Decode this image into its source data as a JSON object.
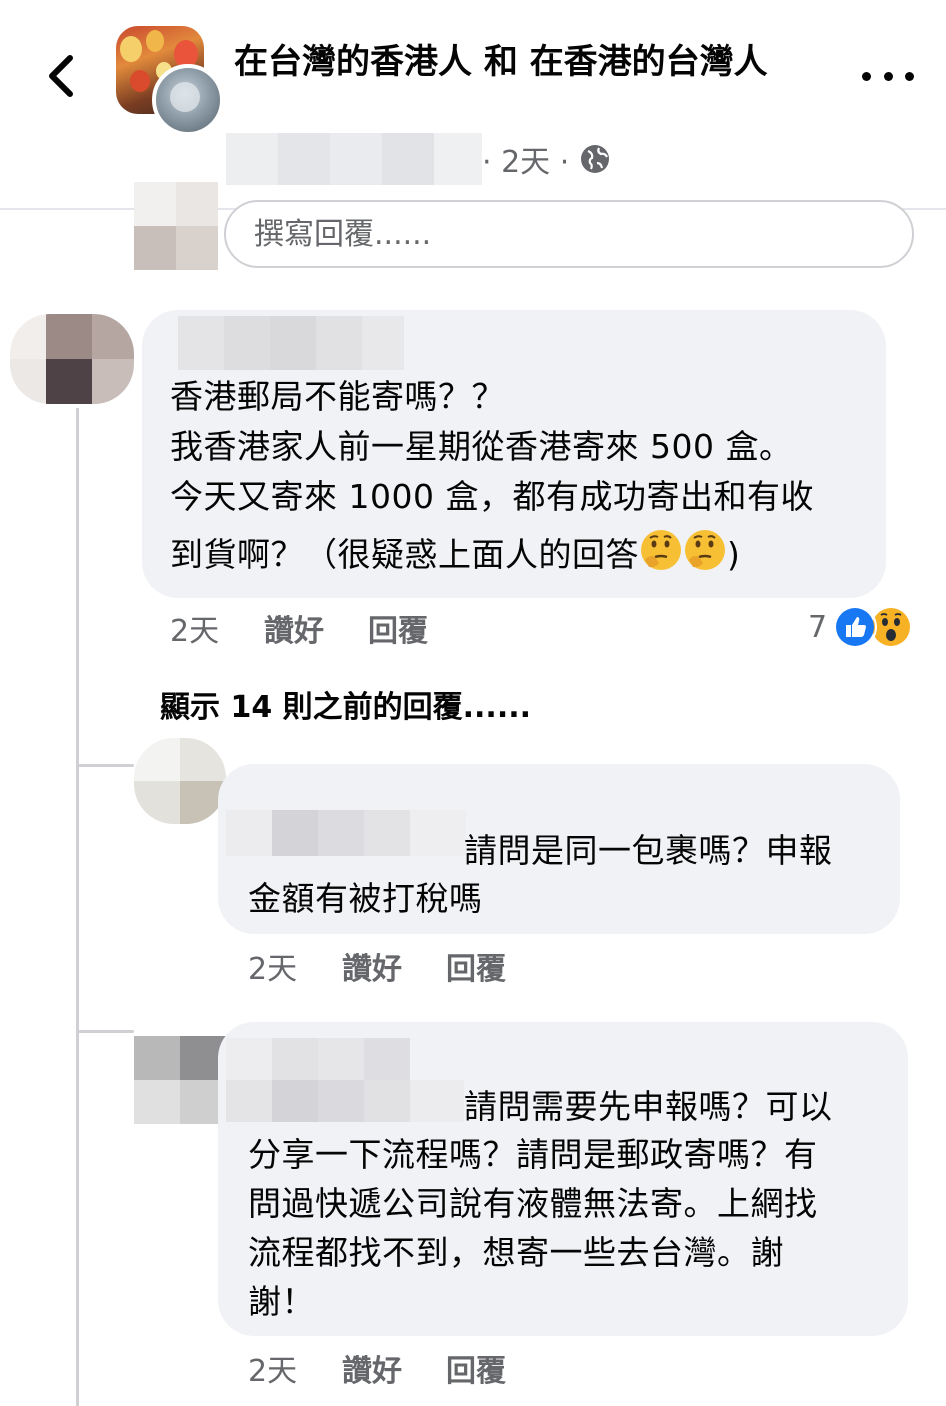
{
  "header": {
    "group_name": "在台灣的香港人 和 在香港的台灣人",
    "post_time": "· 2天 ·",
    "back_icon": "chevron-left-icon",
    "more_icon": "more-horizontal-icon",
    "privacy_icon": "globe-icon"
  },
  "composer": {
    "placeholder": "撰寫回覆......"
  },
  "comments": [
    {
      "text_lines": [
        "香港郵局不能寄嗎？？",
        "我香港家人前一星期從香港寄來 500 盒。",
        "今天又寄來 1000 盒，都有成功寄出和有收",
        "到貨啊？（很疑惑上面人的回答",
        ")"
      ],
      "emoji": [
        "thinking-face",
        "thinking-face"
      ],
      "time": "2天",
      "like_label": "讚好",
      "reply_label": "回覆",
      "reaction_count": "7",
      "reactions": [
        "like-reaction-icon",
        "wow-reaction-icon"
      ]
    }
  ],
  "show_previous": "顯示 14 則之前的回覆......",
  "replies": [
    {
      "line1": "請問是同一包裹嗎？申報",
      "line2": "金額有被打稅嗎",
      "time": "2天",
      "like_label": "讚好",
      "reply_label": "回覆"
    },
    {
      "line1": "請問需要先申報嗎？可以",
      "lines": [
        "分享一下流程嗎？請問是郵政寄嗎？有",
        "問過快遞公司說有液體無法寄。上網找",
        "流程都找不到，想寄一些去台灣。謝",
        "謝！"
      ],
      "time": "2天",
      "like_label": "讚好",
      "reply_label": "回覆"
    }
  ],
  "colors": {
    "bubble": "#f0f2f5",
    "meta_text": "#65676b",
    "like_blue": "#1877f2",
    "wow_yellow": "#f7b125"
  }
}
